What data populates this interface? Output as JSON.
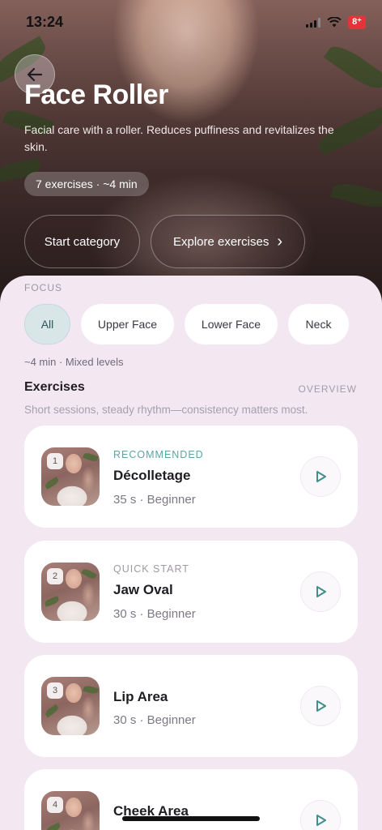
{
  "status_bar": {
    "time": "13:24",
    "battery": "8⁺"
  },
  "hero": {
    "title": "Face Roller",
    "subtitle": "Facial care with a roller. Reduces puffiness and revitalizes the skin.",
    "meta_pill": "7 exercises · ~4 min",
    "start_button": "Start category",
    "explore_button": "Explore exercises",
    "explore_chevron": "›"
  },
  "focus": {
    "label": "FOCUS",
    "chips": [
      {
        "label": "All",
        "active": true
      },
      {
        "label": "Upper Face",
        "active": false
      },
      {
        "label": "Lower Face",
        "active": false
      },
      {
        "label": "Neck",
        "active": false
      }
    ],
    "meta": "~4 min · Mixed levels"
  },
  "exercises_section": {
    "title": "Exercises",
    "overview_link": "OVERVIEW",
    "subtitle": "Short sessions, steady rhythm—consistency matters most."
  },
  "exercises": [
    {
      "number": "1",
      "tag": "RECOMMENDED",
      "tag_color": "#5fa3a3",
      "name": "Décolletage",
      "meta": "35 s · Beginner"
    },
    {
      "number": "2",
      "tag": "QUICK START",
      "tag_color": "#9e99a2",
      "name": "Jaw Oval",
      "meta": "30 s · Beginner"
    },
    {
      "number": "3",
      "tag": "",
      "tag_color": "",
      "name": "Lip Area",
      "meta": "30 s · Beginner"
    },
    {
      "number": "4",
      "tag": "",
      "tag_color": "",
      "name": "Cheek Area",
      "meta": ""
    }
  ],
  "icons": {
    "back": "arrow-left-icon",
    "play": "play-icon",
    "chevron": "chevron-right-icon"
  },
  "colors": {
    "accent_teal": "#3f8f8a",
    "sheet_bg": "#f3e8f2",
    "chip_active_bg": "#d9e6e8"
  }
}
